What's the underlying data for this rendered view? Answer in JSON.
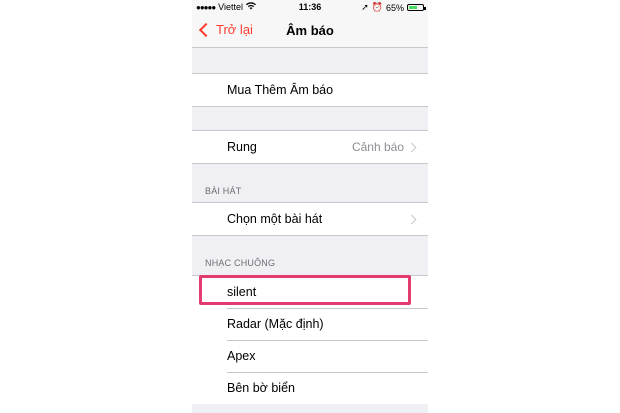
{
  "status_bar": {
    "signal_dots": "●●●●●",
    "carrier": "Viettel",
    "wifi_icon": "wifi-icon",
    "time": "11:36",
    "location_icon": "➚",
    "alarm_icon": "⏰",
    "battery_text": "65%",
    "battery_level": 0.65
  },
  "nav": {
    "back_label": "Trở lại",
    "title": "Âm báo"
  },
  "sections": {
    "store": {
      "item_label": "Mua Thêm Âm báo"
    },
    "vibration": {
      "label": "Rung",
      "value": "Cảnh báo"
    },
    "songs": {
      "header": "BÀI HÁT",
      "item_label": "Chọn một bài hát"
    },
    "ringtones": {
      "header": "NHẠC CHUÔNG",
      "items": [
        "silent",
        "Radar (Mặc định)",
        "Apex",
        "Bên bờ biển"
      ]
    }
  },
  "colors": {
    "accent": "#ff3b30",
    "highlight_border": "#e33b6f",
    "background": "#efeff4"
  }
}
